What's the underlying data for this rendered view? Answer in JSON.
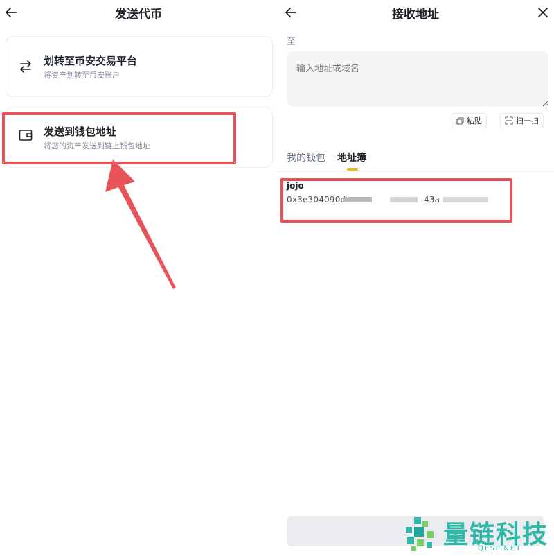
{
  "left": {
    "title": "发送代币",
    "back_icon": "arrow-left-icon",
    "option_transfer": {
      "icon": "swap-arrows-icon",
      "title": "划转至币安交易平台",
      "subtitle": "将资产划转至币安账户"
    },
    "option_send": {
      "icon": "wallet-icon",
      "title": "发送到钱包地址",
      "subtitle": "将您的资产发送到链上钱包地址"
    },
    "annotation_color": "#e8535a"
  },
  "right": {
    "title": "接收地址",
    "back_icon": "arrow-left-icon",
    "close_icon": "close-icon",
    "to_label": "至",
    "address_placeholder": "输入地址或域名",
    "paste_label": "粘贴",
    "scan_label": "扫一扫",
    "tabs": [
      {
        "label": "我的钱包",
        "active": false
      },
      {
        "label": "地址簿",
        "active": true
      }
    ],
    "address_book": [
      {
        "name": "jojo",
        "address_prefix": "0x3e304090d",
        "address_middle": "43a"
      }
    ],
    "accent": "#f0b90b"
  },
  "watermark": {
    "name": "量链科技",
    "domain": "QFSP.NET",
    "color": "#2fb7a7"
  }
}
